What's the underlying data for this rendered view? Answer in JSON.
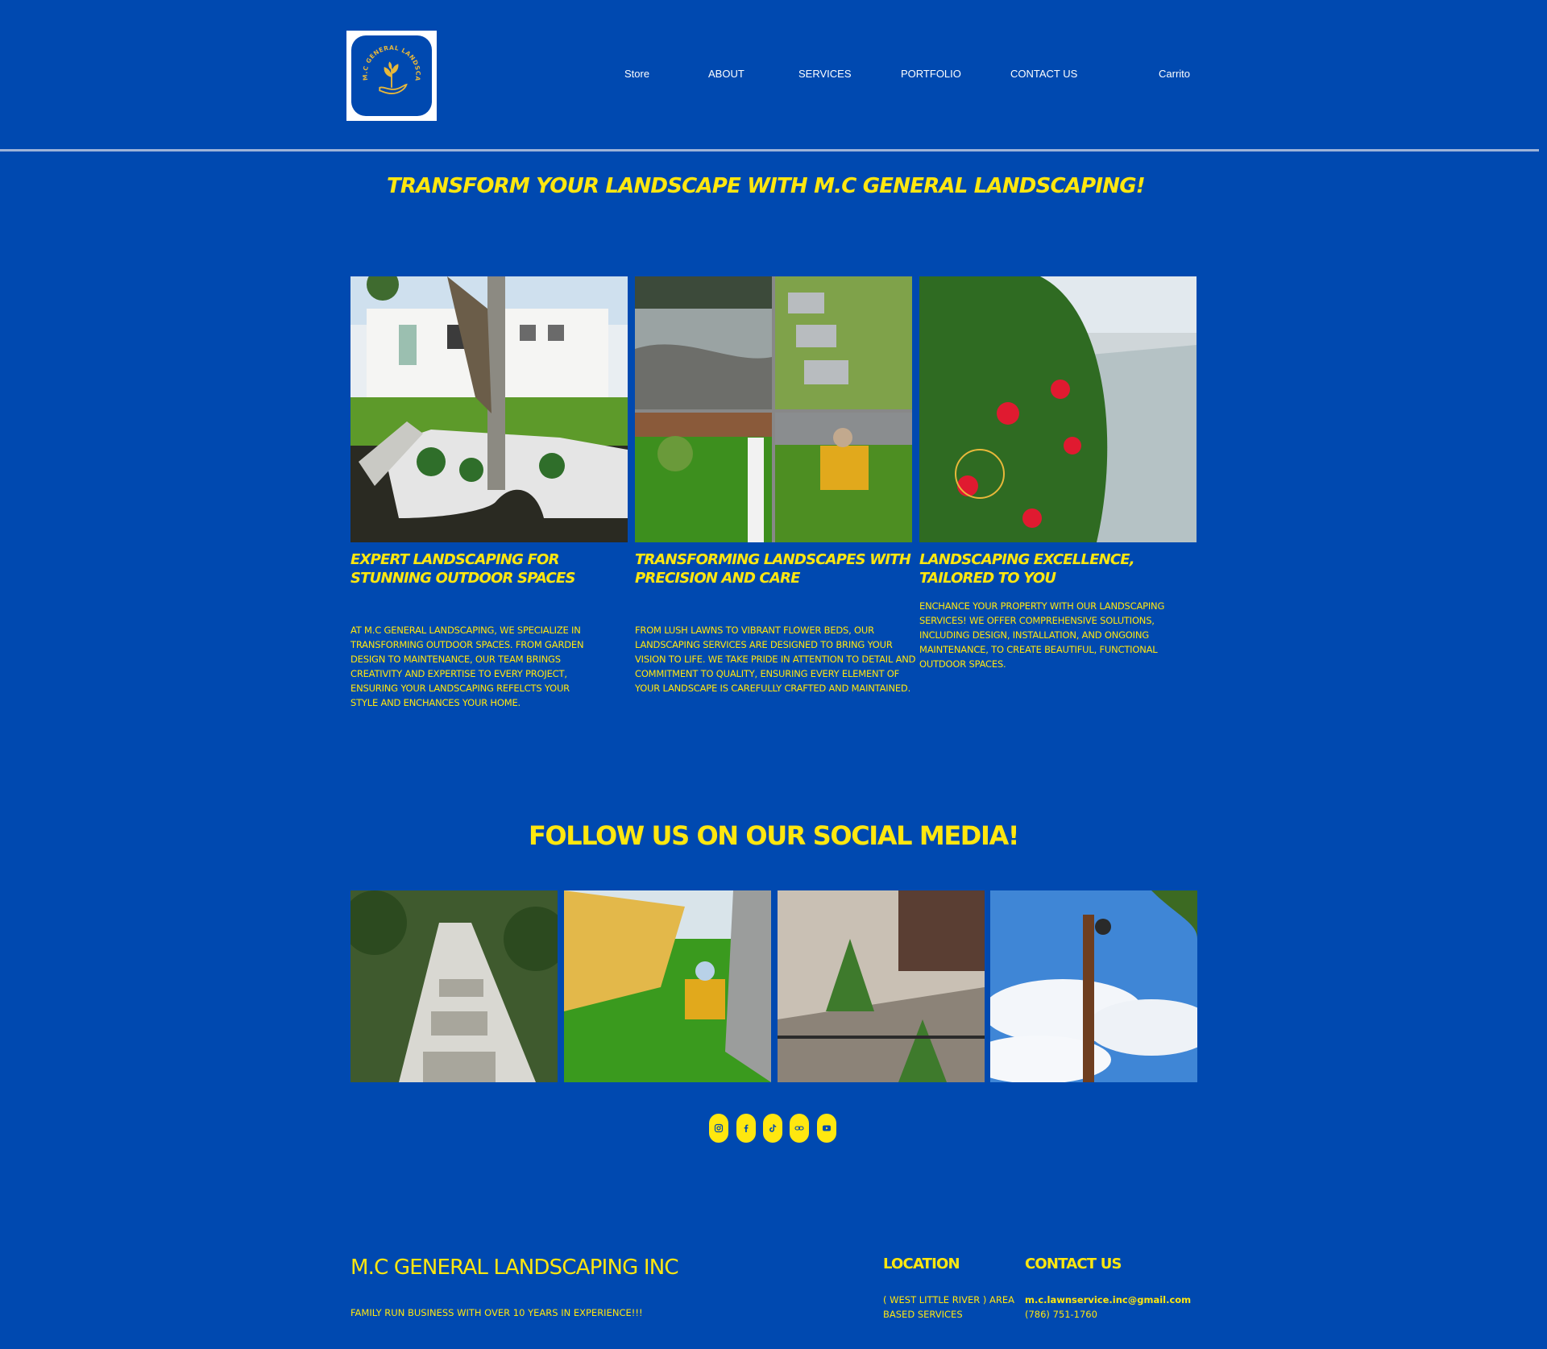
{
  "brand": {
    "logo_text": "M.C GENERAL LANDSCAPING, INC"
  },
  "nav": {
    "items": [
      {
        "label": "Store"
      },
      {
        "label": "ABOUT"
      },
      {
        "label": "SERVICES"
      },
      {
        "label": "PORTFOLIO"
      },
      {
        "label": "CONTACT US"
      }
    ],
    "cart_label": "Carrito"
  },
  "hero": {
    "title": "TRANSFORM YOUR LANDSCAPE WITH M.C GENERAL LANDSCAPING!"
  },
  "features": [
    {
      "heading": "EXPERT LANDSCAPING FOR STUNNING OUTDOOR SPACES",
      "body": "AT M.C GENERAL LANDSCAPING, WE SPECIALIZE IN TRANSFORMING OUTDOOR SPACES. FROM GARDEN DESIGN TO MAINTENANCE, OUR TEAM BRINGS CREATIVITY AND EXPERTISE TO EVERY PROJECT, ENSURING YOUR LANDSCAPING REFELCTS YOUR STYLE AND ENCHANCES YOUR HOME."
    },
    {
      "heading": "TRANSFORMING LANDSCAPES WITH PRECISION AND CARE",
      "body": "FROM LUSH LAWNS TO VIBRANT FLOWER BEDS, OUR LANDSCAPING SERVICES ARE DESIGNED TO BRING YOUR VISION TO LIFE. WE TAKE PRIDE IN ATTENTION TO DETAIL AND COMMITMENT TO QUALITY, ENSURING EVERY ELEMENT OF YOUR LANDSCAPE IS CAREFULLY CRAFTED AND MAINTAINED."
    },
    {
      "heading": "LANDSCAPING EXCELLENCE, TAILORED TO YOU",
      "body": "ENCHANCE YOUR PROPERTY WITH OUR LANDSCAPING SERVICES! WE OFFER COMPREHENSIVE SOLUTIONS, INCLUDING DESIGN, INSTALLATION, AND ONGOING MAINTENANCE, TO CREATE BEAUTIFUL, FUNCTIONAL OUTDOOR SPACES."
    }
  ],
  "social": {
    "title": "FOLLOW US ON OUR SOCIAL MEDIA!",
    "icons": [
      "instagram-icon",
      "facebook-icon",
      "tiktok-icon",
      "link-icon",
      "youtube-icon"
    ]
  },
  "footer": {
    "brand": "M.C GENERAL LANDSCAPING INC",
    "tagline": "FAMILY RUN BUSINESS WITH OVER 10 YEARS IN EXPERIENCE!!!",
    "location_heading": "LOCATION",
    "location_text": "( WEST LITTLE RIVER ) AREA BASED SERVICES",
    "contact_heading": "CONTACT US",
    "email": "m.c.lawnservice.inc@gmail.com",
    "phone": "(786) 751-1760"
  },
  "colors": {
    "background": "#0049B0",
    "accent_yellow": "#FFE70F",
    "nav_text": "#FFFFFF"
  }
}
